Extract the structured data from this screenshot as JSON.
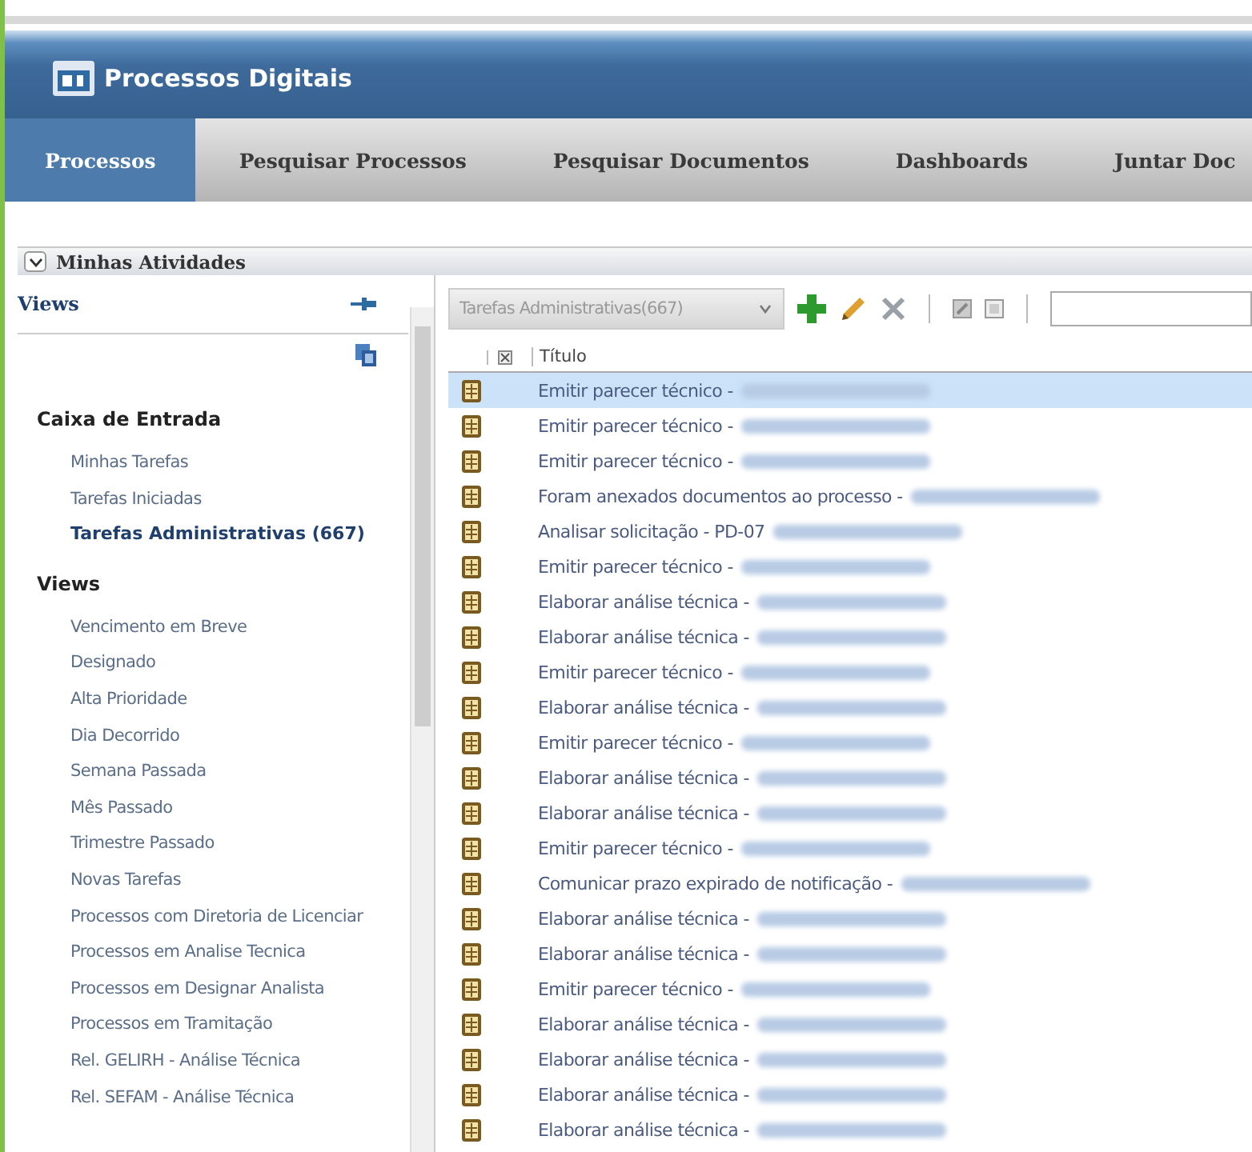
{
  "app": {
    "title": "Processos Digitais"
  },
  "tabs": [
    {
      "label": "Processos",
      "selected": true
    },
    {
      "label": "Pesquisar Processos",
      "selected": false
    },
    {
      "label": "Pesquisar Documentos",
      "selected": false
    },
    {
      "label": "Dashboards",
      "selected": false
    },
    {
      "label": "Juntar Doc",
      "selected": false
    }
  ],
  "section": {
    "title": "Minhas Atividades",
    "expanded": true
  },
  "sidebar": {
    "title": "Views",
    "groups": [
      {
        "title": "Caixa de Entrada",
        "items": [
          {
            "label": "Minhas Tarefas",
            "selected": false
          },
          {
            "label": "Tarefas Iniciadas",
            "selected": false
          },
          {
            "label": "Tarefas Administrativas (667)",
            "selected": true
          }
        ]
      },
      {
        "title": "Views",
        "items": [
          {
            "label": "Vencimento em Breve",
            "selected": false
          },
          {
            "label": "Designado",
            "selected": false
          },
          {
            "label": "Alta Prioridade",
            "selected": false
          },
          {
            "label": "Dia Decorrido",
            "selected": false
          },
          {
            "label": "Semana Passada",
            "selected": false
          },
          {
            "label": "Mês Passado",
            "selected": false
          },
          {
            "label": "Trimestre Passado",
            "selected": false
          },
          {
            "label": "Novas Tarefas",
            "selected": false
          },
          {
            "label": "Processos com Diretoria de Licenciar",
            "selected": false
          },
          {
            "label": "Processos em Analise Tecnica",
            "selected": false
          },
          {
            "label": "Processos em Designar Analista",
            "selected": false
          },
          {
            "label": "Processos em Tramitação",
            "selected": false
          },
          {
            "label": "Rel. GELIRH - Análise Técnica",
            "selected": false
          },
          {
            "label": "Rel. SEFAM - Análise Técnica",
            "selected": false
          }
        ]
      }
    ]
  },
  "toolbar": {
    "view_select": "Tarefas Administrativas(667)"
  },
  "table": {
    "columns": [
      "Título"
    ],
    "rows": [
      {
        "title": "Emitir parecer técnico -",
        "blurred": true,
        "selected": true
      },
      {
        "title": "Emitir parecer técnico -",
        "blurred": true,
        "selected": false
      },
      {
        "title": "Emitir parecer técnico -",
        "blurred": true,
        "selected": false
      },
      {
        "title": "Foram anexados documentos ao processo -",
        "blurred": true,
        "selected": false
      },
      {
        "title": "Analisar solicitação - PD-07",
        "blurred": true,
        "selected": false
      },
      {
        "title": "Emitir parecer técnico -",
        "blurred": true,
        "selected": false
      },
      {
        "title": "Elaborar análise técnica -",
        "blurred": true,
        "selected": false
      },
      {
        "title": "Elaborar análise técnica -",
        "blurred": true,
        "selected": false
      },
      {
        "title": "Emitir parecer técnico -",
        "blurred": true,
        "selected": false
      },
      {
        "title": "Elaborar análise técnica -",
        "blurred": true,
        "selected": false
      },
      {
        "title": "Emitir parecer técnico -",
        "blurred": true,
        "selected": false
      },
      {
        "title": "Elaborar análise técnica -",
        "blurred": true,
        "selected": false
      },
      {
        "title": "Elaborar análise técnica -",
        "blurred": true,
        "selected": false
      },
      {
        "title": "Emitir parecer técnico -",
        "blurred": true,
        "selected": false
      },
      {
        "title": "Comunicar prazo expirado de notificação -",
        "blurred": true,
        "selected": false
      },
      {
        "title": "Elaborar análise técnica -",
        "blurred": true,
        "selected": false
      },
      {
        "title": "Elaborar análise técnica -",
        "blurred": true,
        "selected": false
      },
      {
        "title": "Emitir parecer técnico -",
        "blurred": true,
        "selected": false
      },
      {
        "title": "Elaborar análise técnica -",
        "blurred": true,
        "selected": false
      },
      {
        "title": "Elaborar análise técnica -",
        "blurred": true,
        "selected": false
      },
      {
        "title": "Elaborar análise técnica -",
        "blurred": true,
        "selected": false
      },
      {
        "title": "Elaborar análise técnica -",
        "blurred": true,
        "selected": false
      }
    ]
  }
}
